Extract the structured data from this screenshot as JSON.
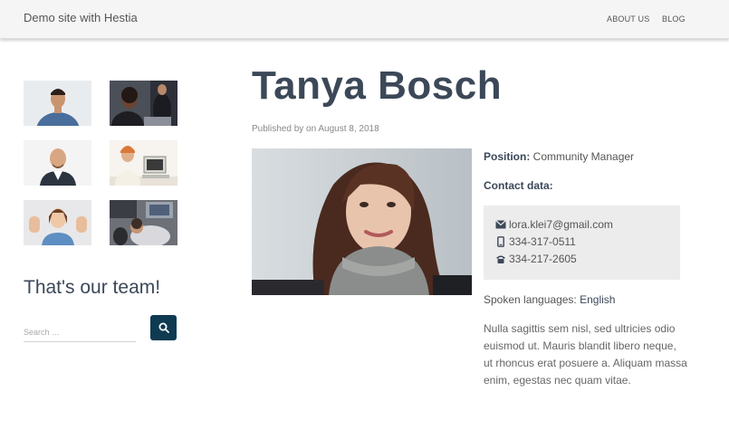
{
  "header": {
    "site_title": "Demo site with Hestia",
    "nav": [
      {
        "label": "ABOUT US"
      },
      {
        "label": "BLOG"
      }
    ]
  },
  "sidebar": {
    "heading": "That's our team!",
    "search": {
      "placeholder": "Search …"
    }
  },
  "post": {
    "title": "Tanya Bosch",
    "meta": "Published by on August 8, 2018",
    "position_label": "Position:",
    "position_value": "Community Manager",
    "contact_label": "Contact data:",
    "email": "lora.klei7@gmail.com",
    "mobile": "334-317-0511",
    "phone": "334-217-2605",
    "languages_label": "Spoken languages:",
    "languages_value": "English",
    "description": "Nulla sagittis sem nisl, sed ultricies odio euismod ut. Mauris blandit libero neque, ut rhoncus erat posuere a. Aliquam massa enim, egestas nec quam vitae."
  },
  "colors": {
    "accent": "#0f3a52",
    "title": "#3c4858",
    "contact_bg": "#ececec"
  }
}
